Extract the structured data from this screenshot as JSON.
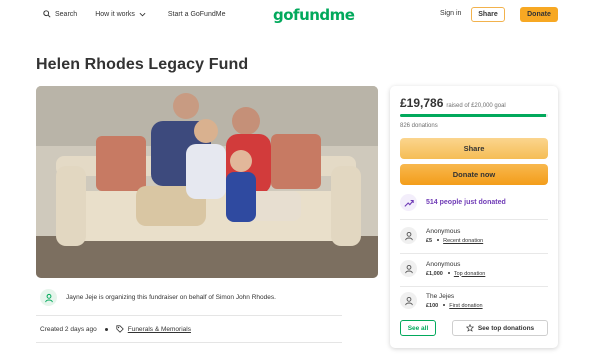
{
  "header": {
    "search_label": "Search",
    "how_it_works_label": "How it works",
    "start_label": "Start a GoFundMe",
    "logo_text": "gofundme",
    "signin_label": "Sign in",
    "share_label": "Share",
    "donate_label": "Donate"
  },
  "campaign": {
    "title": "Helen Rhodes Legacy Fund",
    "organizer_text": "Jayne Jeje is organizing this fundraiser on behalf of Simon John Rhodes.",
    "created": "Created 2 days ago",
    "category": "Funerals & Memorials"
  },
  "sidebar": {
    "raised_amount": "£19,786",
    "raised_goal": "raised of £20,000 goal",
    "progress_fraction": 0.989,
    "donation_count": "826 donations",
    "share_label": "Share",
    "donate_label": "Donate now",
    "recent_activity": "514 people just donated",
    "donations": [
      {
        "name": "Anonymous",
        "amount": "£5",
        "tag": "Recent donation"
      },
      {
        "name": "Anonymous",
        "amount": "£1,000",
        "tag": "Top donation"
      },
      {
        "name": "The Jejes",
        "amount": "£100",
        "tag": "First donation"
      }
    ],
    "see_all_label": "See all",
    "see_top_label": "See top donations"
  },
  "colors": {
    "brand_green": "#02a95c",
    "donate_orange": "#f7a823",
    "share_yellow": "#f5bd55",
    "recent_purple": "#6f3bb6"
  },
  "icons": [
    "search-icon",
    "chevron-down-icon",
    "shield-user-icon",
    "tag-icon",
    "trend-up-icon",
    "donor-icon",
    "star-icon"
  ]
}
